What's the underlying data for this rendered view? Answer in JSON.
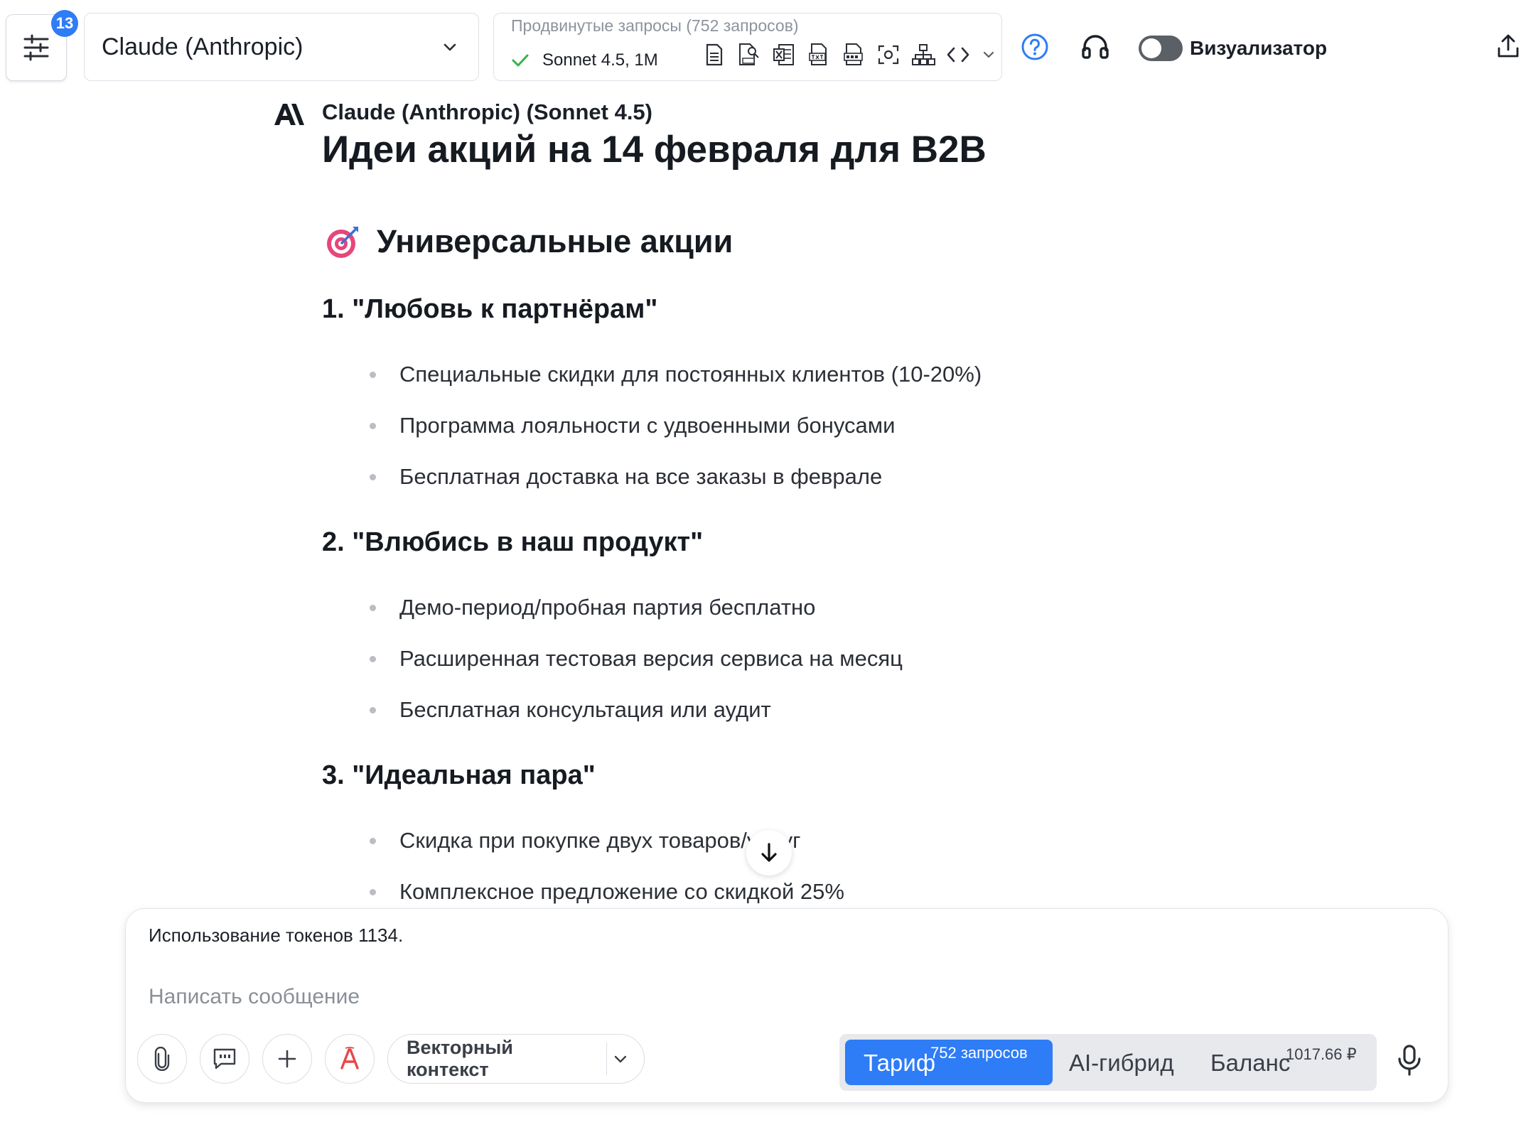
{
  "header": {
    "settings_badge": "13",
    "model_select_label": "Claude (Anthropic)",
    "advanced_title": "Продвинутые запросы (752 запросов)",
    "advanced_model": "Sonnet 4.5, 1M",
    "visualizer_label": "Визуализатор",
    "visualizer_on": false
  },
  "response": {
    "assistant_name": "Claude (Anthropic) (Sonnet 4.5)",
    "title": "Идеи акций на 14 февраля для B2B",
    "section_emoji": "🎯",
    "section_heading": "Универсальные акции",
    "groups": [
      {
        "heading": "1. \"Любовь к партнёрам\"",
        "items": [
          "Специальные скидки для постоянных клиентов (10-20%)",
          "Программа лояльности с удвоенными бонусами",
          "Бесплатная доставка на все заказы в феврале"
        ]
      },
      {
        "heading": "2. \"Влюбись в наш продукт\"",
        "items": [
          "Демо-период/пробная партия бесплатно",
          "Расширенная тестовая версия сервиса на месяц",
          "Бесплатная консультация или аудит"
        ]
      },
      {
        "heading": "3. \"Идеальная пара\"",
        "items": [
          "Скидка при покупке двух товаров/услуг",
          "Комплексное предложение со скидкой 25%"
        ]
      }
    ]
  },
  "composer": {
    "token_usage": "Использование токенов 1134.",
    "placeholder": "Написать сообщение",
    "value": "",
    "vector_context_label": "Векторный контекст",
    "plan_label": "Тариф",
    "plan_requests": "752 запросов",
    "hybrid_label": "AI-гибрид",
    "balance_label": "Баланс",
    "balance_value": "1017.66 ₽"
  },
  "colors": {
    "accent": "#2e7cf6",
    "check_green": "#35b34a",
    "text": "#1b1f27",
    "muted": "#8a8f97"
  }
}
